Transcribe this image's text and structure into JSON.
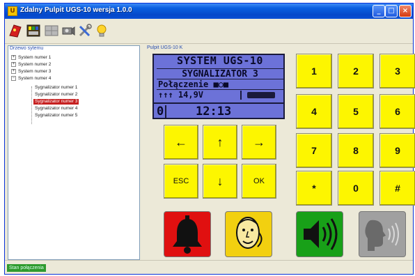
{
  "window": {
    "title": "Zdalny Pulpit UGS-10 wersja 1.0.0",
    "title_icon_glyph": "U",
    "btn_min": "_",
    "btn_max": "□",
    "btn_close": "×"
  },
  "toolbar": {
    "items": [
      {
        "icon": "red-flag-icon"
      },
      {
        "icon": "panel-icon"
      },
      {
        "icon": "grid-icon"
      },
      {
        "icon": "camera-icon"
      },
      {
        "icon": "tools-icon"
      },
      {
        "icon": "lightbulb-icon"
      }
    ]
  },
  "tree": {
    "header": "Drzewo sytemu",
    "nodes": [
      {
        "label": "System numer 1",
        "expander": "+"
      },
      {
        "label": "System numer 2",
        "expander": "+"
      },
      {
        "label": "System numer 3",
        "expander": "+"
      },
      {
        "label": "System numer 4",
        "expander": "−"
      }
    ],
    "children": [
      {
        "label": "Sygnalizator numer 1",
        "selected": false
      },
      {
        "label": "Sygnalizator numer 2",
        "selected": false
      },
      {
        "label": "Sygnalizator numer 3",
        "selected": true
      },
      {
        "label": "Sygnalizator numer 4",
        "selected": false
      },
      {
        "label": "Sygnalizator numer 5",
        "selected": false
      }
    ]
  },
  "panel": {
    "label": "Pulpit UGS-10 K"
  },
  "lcd": {
    "line1": "SYSTEM UGS-10",
    "line2": "SYGNALIZATOR 3",
    "line3": "Połączenie ■○■",
    "line4": "↑↑↑ 14,9V",
    "line5_left": "0",
    "line5_time": "12:13"
  },
  "keys": {
    "left": "←",
    "up": "↑",
    "right": "→",
    "esc": "ESC",
    "down": "↓",
    "ok": "OK",
    "numpad": [
      "1",
      "2",
      "3",
      "4",
      "5",
      "6",
      "7",
      "8",
      "9",
      "*",
      "0",
      "#"
    ]
  },
  "actions": [
    {
      "icon": "alarm-bell-icon"
    },
    {
      "icon": "announcer-face-icon"
    },
    {
      "icon": "speaker-icon"
    },
    {
      "icon": "voice-icon"
    }
  ],
  "status": {
    "text": "Stan połączenia"
  },
  "colors": {
    "lcd_bg": "#6c72d8",
    "key_yellow": "#fdf600",
    "alarm_red": "#e01010",
    "speaker_green": "#18a018",
    "status_green": "#2e9a2e"
  }
}
